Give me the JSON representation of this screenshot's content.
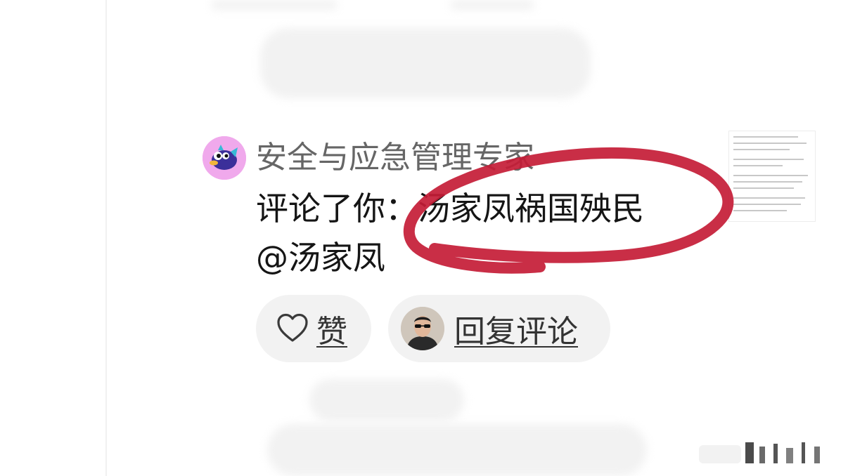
{
  "notification": {
    "sender_name": "安全与应急管理专家",
    "comment_text": "评论了你：汤家凤祸国殃民",
    "mention_text": "@汤家凤",
    "like_label": "赞",
    "reply_label": "回复评论"
  },
  "colors": {
    "annotation": "#c41c36",
    "pill_background": "#f2f2f2",
    "sender_avatar_bg": "#f0a9ec"
  },
  "icons": {
    "sender_avatar": "fish-avatar-icon",
    "like": "heart-icon",
    "reply_avatar": "user-avatar"
  }
}
